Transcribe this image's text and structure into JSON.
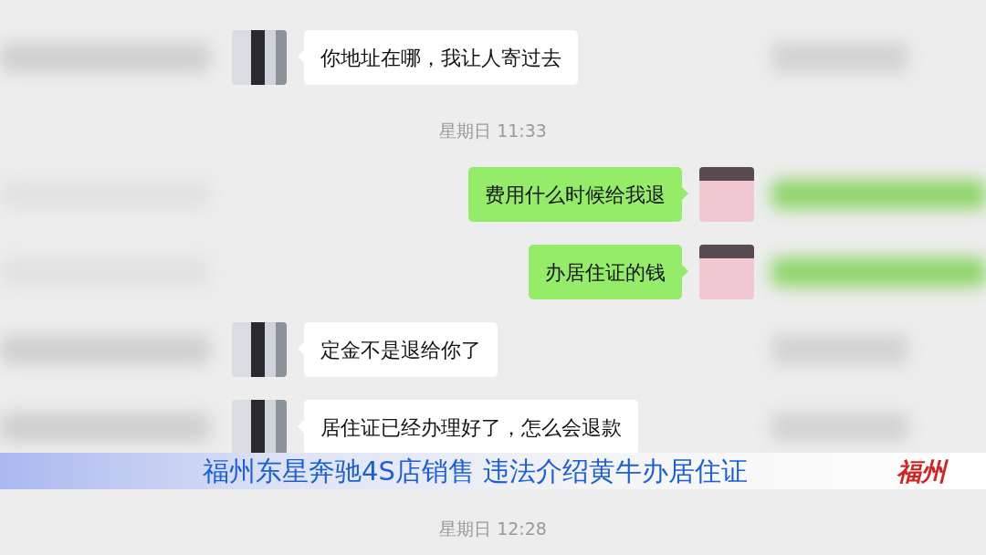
{
  "chat": [
    {
      "kind": "incoming",
      "text": "你地址在哪，我让人寄过去"
    },
    {
      "kind": "time",
      "text": "星期日 11:33"
    },
    {
      "kind": "outgoing",
      "text": "费用什么时候给我退"
    },
    {
      "kind": "outgoing",
      "text": "办居住证的钱"
    },
    {
      "kind": "incoming",
      "text": "定金不是退给你了"
    },
    {
      "kind": "incoming",
      "text": "居住证已经办理好了，怎么会退款"
    },
    {
      "kind": "time",
      "text": "星期日 12:28"
    }
  ],
  "caption": {
    "headline": "福州东星奔驰4S店销售 违法介绍黄牛办居住证",
    "location": "福州"
  }
}
